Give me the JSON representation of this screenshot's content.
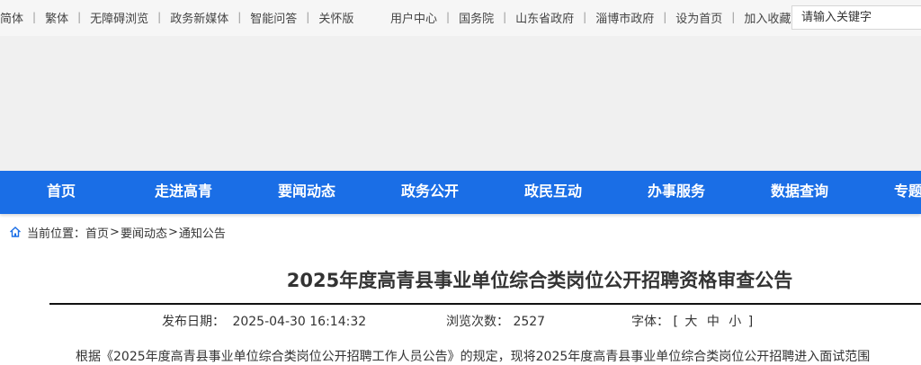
{
  "topbar": {
    "left_links": [
      "简体",
      "繁体",
      "无障碍浏览",
      "政务新媒体",
      "智能问答",
      "关怀版"
    ],
    "right_links": [
      "用户中心",
      "国务院",
      "山东省政府",
      "淄博市政府",
      "设为首页",
      "加入收藏"
    ],
    "separator": "|",
    "search_placeholder": "请输入关键字"
  },
  "nav": {
    "items": [
      "首页",
      "走进高青",
      "要闻动态",
      "政务公开",
      "政民互动",
      "办事服务",
      "数据查询",
      "专题"
    ]
  },
  "breadcrumb": {
    "label": "当前位置：",
    "items": [
      "首页",
      "要闻动态",
      "通知公告"
    ],
    "separator": ">"
  },
  "article": {
    "title": "2025年度高青县事业单位综合类岗位公开招聘资格审查公告",
    "publish_label": "发布日期：",
    "publish_date": "2025-04-30 16:14:32",
    "views_label": "浏览次数：",
    "views": "2527",
    "font_label": "字体：",
    "font_bracket_open": "[",
    "font_sizes": [
      "大",
      "中",
      "小"
    ],
    "font_bracket_close": "]",
    "body_first_line": "根据《2025年度高青县事业单位综合类岗位公开招聘工作人员公告》的规定，现将2025年度高青县事业单位综合类岗位公开招聘进入面试范围"
  },
  "colors": {
    "nav_bg": "#1a6ee6",
    "topbar_bg": "#f6f6f6",
    "banner_bg": "#f0f0f0",
    "icon_blue": "#1a6ee6"
  }
}
